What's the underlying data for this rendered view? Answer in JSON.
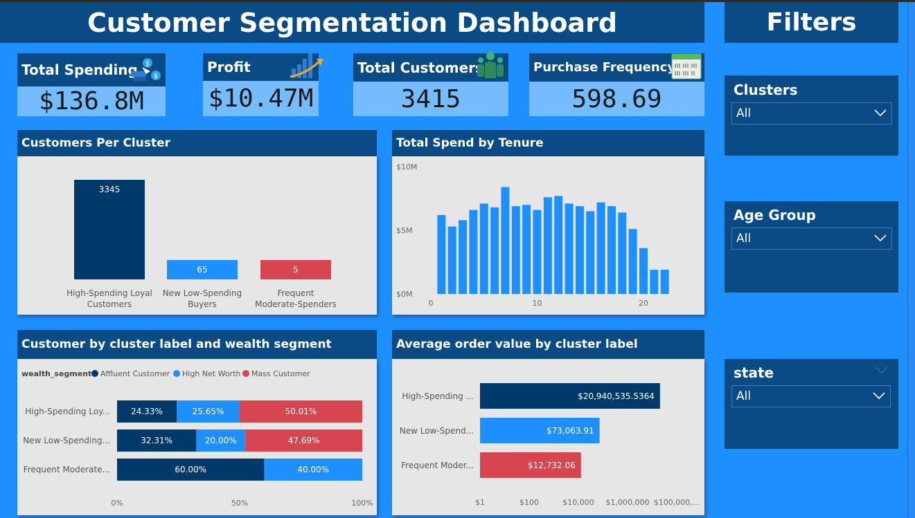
{
  "header": {
    "title": "Customer Segmentation Dashboard",
    "filters_title": "Filters"
  },
  "kpis": [
    {
      "label": "Total Spending",
      "value": "$136.8M",
      "icon": "money-hand-icon"
    },
    {
      "label": "Profit",
      "value": "$10.47M",
      "icon": "growth-chart-icon"
    },
    {
      "label": "Total Customers",
      "value": "3415",
      "icon": "people-icon"
    },
    {
      "label": "Purchase Frequency",
      "value": "598.69",
      "icon": "calendar-icon"
    }
  ],
  "panels": {
    "customers_per_cluster": "Customers Per Cluster",
    "spend_by_tenure": "Total Spend by Tenure",
    "wealth_segment": "Customer by cluster label and wealth segment",
    "avg_order_value": "Average order value by cluster label"
  },
  "filters": [
    {
      "label": "Clusters",
      "value": "All"
    },
    {
      "label": "Age Group",
      "value": "All"
    },
    {
      "label": "state",
      "value": "All"
    }
  ],
  "colors": {
    "navy": "#003a6b",
    "blue": "#1e8fff",
    "red": "#d64550",
    "header": "#0a4a85"
  },
  "chart_data": [
    {
      "type": "bar",
      "title": "Customers Per Cluster",
      "categories": [
        "High-Spending Loyal Customers",
        "New Low-Spending Buyers",
        "Frequent Moderate-Spenders"
      ],
      "category_lines": [
        [
          "High-Spending Loyal",
          "Customers"
        ],
        [
          "New Low-Spending",
          "Buyers"
        ],
        [
          "Frequent",
          "Moderate-Spenders"
        ]
      ],
      "values": [
        3345,
        65,
        5
      ],
      "colors": [
        "#003a6b",
        "#1e8fff",
        "#d64550"
      ]
    },
    {
      "type": "bar",
      "title": "Total Spend by Tenure",
      "x": [
        1,
        2,
        3,
        4,
        5,
        6,
        7,
        8,
        9,
        10,
        11,
        12,
        13,
        14,
        15,
        16,
        17,
        18,
        19,
        20,
        21,
        22
      ],
      "values": [
        6.2,
        5.3,
        5.8,
        6.6,
        7.1,
        6.8,
        8.4,
        6.9,
        7.0,
        6.6,
        7.6,
        7.7,
        7.1,
        6.9,
        6.5,
        7.2,
        6.9,
        6.4,
        5.1,
        3.6,
        1.9,
        1.9
      ],
      "unit": "$M",
      "ylim": [
        0,
        10
      ],
      "yticks": [
        "$0M",
        "$5M",
        "$10M"
      ],
      "xticks": [
        "0",
        "10",
        "20"
      ],
      "xtick_values": [
        0,
        10,
        20
      ]
    },
    {
      "type": "bar",
      "stacked": true,
      "orientation": "horizontal",
      "title": "Customer by cluster label and wealth segment",
      "legend_title": "wealth_segment",
      "categories": [
        "High-Spending Loy...",
        "New Low-Spending...",
        "Frequent Moderate..."
      ],
      "series": [
        {
          "name": "Affluent Customer",
          "color": "#003a6b",
          "values": [
            24.33,
            32.31,
            60.0
          ],
          "labels": [
            "24.33%",
            "32.31%",
            "60.00%"
          ]
        },
        {
          "name": "High Net Worth",
          "color": "#1e8fff",
          "values": [
            25.65,
            20.0,
            40.0
          ],
          "labels": [
            "25.65%",
            "20.00%",
            "40.00%"
          ]
        },
        {
          "name": "Mass Customer",
          "color": "#d64550",
          "values": [
            50.01,
            47.69,
            0
          ],
          "labels": [
            "50.01%",
            "47.69%",
            ""
          ]
        }
      ],
      "xticks": [
        "0%",
        "50%",
        "100%"
      ],
      "xlim": [
        0,
        100
      ]
    },
    {
      "type": "bar",
      "orientation": "horizontal",
      "scale": "log",
      "title": "Average order value by cluster label",
      "categories": [
        "High-Spending ...",
        "New Low-Spend...",
        "Frequent Moder..."
      ],
      "values": [
        20940535.5364,
        73063.91,
        12732.06
      ],
      "labels": [
        "$20,940,535.5364",
        "$73,063.91",
        "$12,732.06"
      ],
      "colors": [
        "#003a6b",
        "#1e8fff",
        "#d64550"
      ],
      "xticks": [
        "$1",
        "$100",
        "$10,000",
        "$1,000,000",
        "$100,000,..."
      ],
      "xtick_values": [
        1,
        100,
        10000,
        1000000,
        100000000
      ]
    }
  ]
}
